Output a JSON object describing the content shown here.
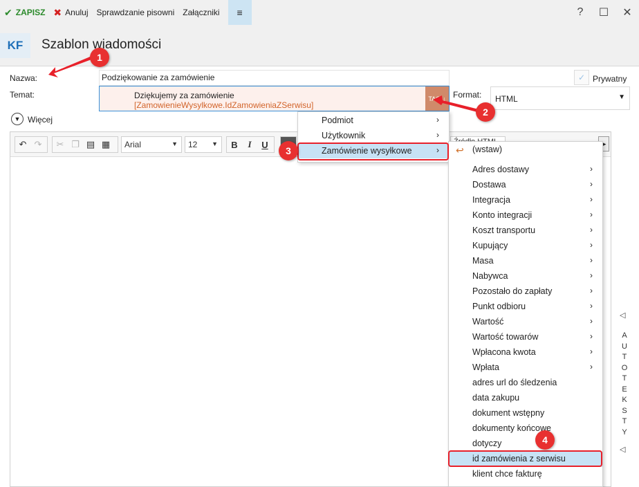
{
  "toolbar": {
    "save_label": "ZAPISZ",
    "cancel_label": "Anuluj",
    "spellcheck_label": "Sprawdzanie pisowni",
    "attachments_label": "Załączniki",
    "menu_icon": "≡",
    "help_icon": "?",
    "maximize_icon": "☐",
    "close_icon": "✕"
  },
  "header": {
    "initials": "KF",
    "title": "Szablon wiadomości"
  },
  "form": {
    "name_label": "Nazwa:",
    "name_value": "Podziękowanie za zamówienie",
    "subject_label": "Temat:",
    "subject_line1": "Dziękujemy za zamówienie",
    "subject_line2": "[ZamowienieWysylkowe.IdZamowieniaZSerwisu]",
    "tag_label": "TAG",
    "private_label": "Prywatny",
    "format_label": "Format:",
    "format_value": "HTML",
    "more_label": "Więcej"
  },
  "editor": {
    "font_name": "Arial",
    "font_size": "12",
    "bold": "B",
    "italic": "I",
    "underline": "U",
    "partial_label": "Źródło HTML"
  },
  "side": {
    "autoteksty_letters": [
      "A",
      "U",
      "T",
      "O",
      "T",
      "E",
      "K",
      "S",
      "T",
      "Y"
    ]
  },
  "menu1": {
    "items": [
      {
        "label": "Podmiot",
        "has_submenu": true
      },
      {
        "label": "Użytkownik",
        "has_submenu": true
      },
      {
        "label": "Zamówienie wysyłkowe",
        "has_submenu": true,
        "active": true
      }
    ]
  },
  "menu2": {
    "items": [
      {
        "label": "(wstaw)",
        "has_submenu": false
      },
      {
        "label": "Adres dostawy",
        "has_submenu": true
      },
      {
        "label": "Dostawa",
        "has_submenu": true
      },
      {
        "label": "Integracja",
        "has_submenu": true
      },
      {
        "label": "Konto integracji",
        "has_submenu": true
      },
      {
        "label": "Koszt transportu",
        "has_submenu": true
      },
      {
        "label": "Kupujący",
        "has_submenu": true
      },
      {
        "label": "Masa",
        "has_submenu": true
      },
      {
        "label": "Nabywca",
        "has_submenu": true
      },
      {
        "label": "Pozostało do zapłaty",
        "has_submenu": true
      },
      {
        "label": "Punkt odbioru",
        "has_submenu": true
      },
      {
        "label": "Wartość",
        "has_submenu": true
      },
      {
        "label": "Wartość towarów",
        "has_submenu": true
      },
      {
        "label": "Wpłacona kwota",
        "has_submenu": true
      },
      {
        "label": "Wpłata",
        "has_submenu": true
      },
      {
        "label": "adres url do śledzenia",
        "has_submenu": false
      },
      {
        "label": "data zakupu",
        "has_submenu": false
      },
      {
        "label": "dokument wstępny",
        "has_submenu": false
      },
      {
        "label": "dokumenty końcowe",
        "has_submenu": false
      },
      {
        "label": "dotyczy",
        "has_submenu": false
      },
      {
        "label": "id zamówienia z serwisu",
        "has_submenu": false,
        "highlight": true
      },
      {
        "label": "klient chce fakturę",
        "has_submenu": false
      }
    ]
  },
  "annotations": {
    "badge_1": "1",
    "badge_2": "2",
    "badge_3": "3",
    "badge_4": "4",
    "color": "#e8202a"
  }
}
